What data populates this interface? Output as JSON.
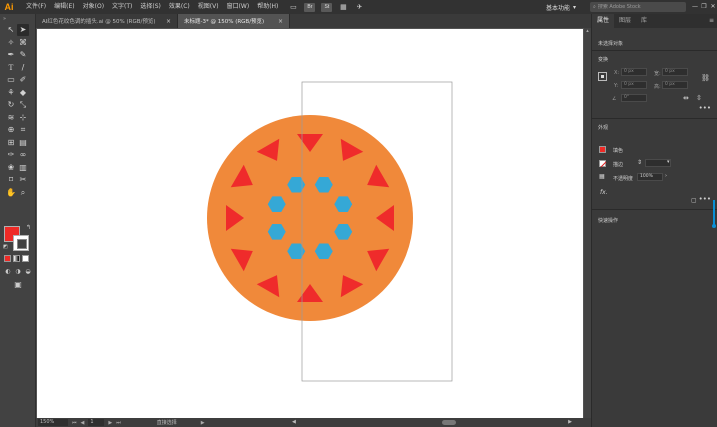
{
  "app": {
    "logo": "Ai"
  },
  "menu": [
    "文件(F)",
    "编辑(E)",
    "对象(O)",
    "文字(T)",
    "选择(S)",
    "效果(C)",
    "视图(V)",
    "窗口(W)",
    "帮助(H)"
  ],
  "menubar_buttons": {
    "bridge": "Br",
    "stock": "St"
  },
  "workspace": {
    "label": "基本功能",
    "chevron": "▾"
  },
  "stock_search": {
    "placeholder": "搜索 Adobe Stock"
  },
  "window_controls": {
    "minimize": "—",
    "restore": "❐",
    "close": "✕"
  },
  "tabs": [
    {
      "label": "AI红色花纹色调的插头.ai @ 50% (RGB/预览)",
      "close": "×",
      "active": false
    },
    {
      "label": "未标题-3* @ 150% (RGB/预览)",
      "close": "×",
      "active": true
    }
  ],
  "toolbar": {
    "grip": "»"
  },
  "statusbar": {
    "zoom": "150%",
    "page": "1",
    "nav_first": "⏮",
    "nav_prev": "◀",
    "nav_next": "▶",
    "nav_last": "⏭",
    "status": "直接选择",
    "arrow_right": "▶",
    "scroll_left": "◀",
    "scroll_right": "▶"
  },
  "panel": {
    "tabs": [
      "属性",
      "图层",
      "库"
    ],
    "menu_icon": "≡",
    "selection_label": "未选择对象",
    "transform_title": "变换",
    "x_label": "X:",
    "y_label": "Y:",
    "w_label": "宽:",
    "h_label": "高:",
    "x_value": "0 px",
    "y_value": "0 px",
    "w_value": "0 px",
    "h_value": "0 px",
    "angle_label": "∠",
    "angle_value": "0°",
    "more": "•••",
    "appearance_title": "外观",
    "fill_label": "填色",
    "stroke_label": "描边",
    "stroke_value": "",
    "opacity_label": "不透明度",
    "opacity_value": "100%",
    "fx_label": "fx.",
    "quick_actions_title": "快速操作"
  },
  "colors": {
    "orange": "#f0893a",
    "triangle_red": "#ef2b2b",
    "hexagon_blue": "#35a8d6",
    "fill_swatch": "#ee2a26"
  }
}
